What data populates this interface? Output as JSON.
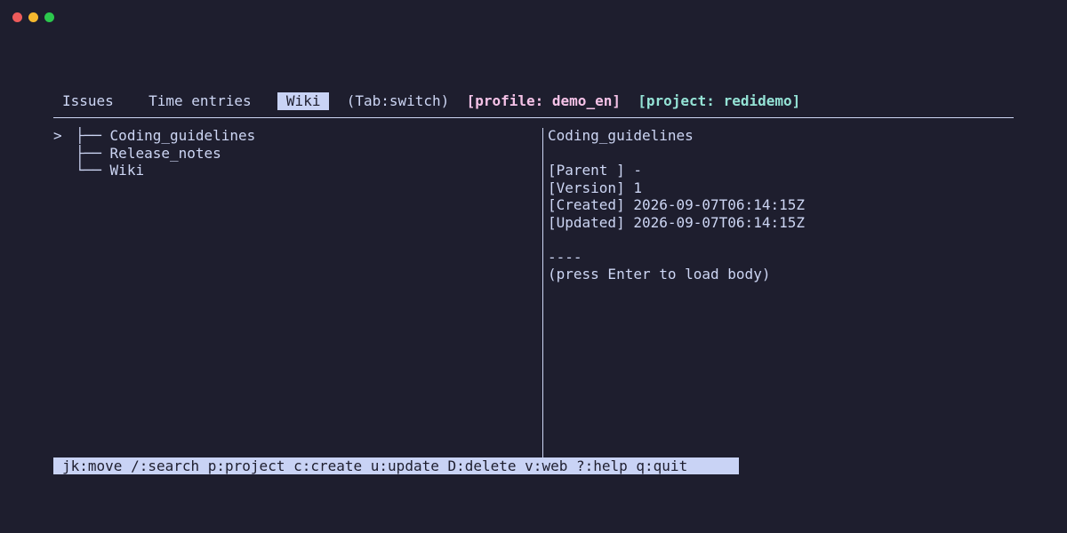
{
  "tabs": [
    {
      "label": "Issues",
      "active": false
    },
    {
      "label": "Time entries",
      "active": false
    },
    {
      "label": "Wiki",
      "active": true
    }
  ],
  "tab_hint": "(Tab:switch)",
  "profile_label": "[profile: demo_en]",
  "project_label": "[project: redidemo]",
  "tree": {
    "cursor": ">",
    "items": [
      {
        "prefix": "├──",
        "label": "Coding_guidelines",
        "selected": true
      },
      {
        "prefix": "├──",
        "label": "Release_notes",
        "selected": false
      },
      {
        "prefix": "└──",
        "label": "Wiki",
        "selected": false
      }
    ]
  },
  "detail": {
    "title": "Coding_guidelines",
    "parent": "[Parent ] -",
    "version": "[Version] 1",
    "created": "[Created] 2026-09-07T06:14:15Z",
    "updated": "[Updated] 2026-09-07T06:14:15Z",
    "separator": "----",
    "hint": "(press Enter to load body)"
  },
  "status_bar": "jk:move /:search p:project c:create u:update D:delete v:web ?:help q:quit"
}
